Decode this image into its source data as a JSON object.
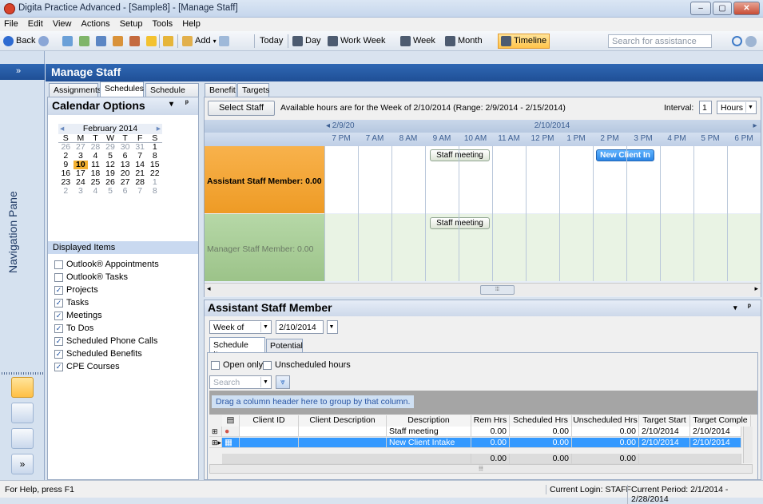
{
  "window": {
    "title": "Digita Practice Advanced - [Sample8] - [Manage Staff]",
    "min": "–",
    "max": "▢",
    "close": "✕"
  },
  "menu": [
    "File",
    "Edit",
    "View",
    "Actions",
    "Setup",
    "Tools",
    "Help"
  ],
  "toolbar": {
    "back": "Back",
    "add": "Add",
    "today": "Today",
    "day": "Day",
    "work_week": "Work Week",
    "week": "Week",
    "month": "Month",
    "timeline": "Timeline",
    "search_placeholder": "Search for assistance"
  },
  "nav": {
    "label": "Navigation Pane",
    "collapse": "»",
    "expand": "»"
  },
  "header": {
    "title": "Manage Staff"
  },
  "tabs_left": [
    "Assignments",
    "Schedules",
    "Schedule Items"
  ],
  "tabs_right": [
    "Benefit",
    "Targets"
  ],
  "calendar_options": {
    "title": "Calendar Options",
    "menu": "▾",
    "pin": "ᵖ",
    "month": "February 2014",
    "prev": "◂",
    "next": "▸",
    "weekdays": [
      "S",
      "M",
      "T",
      "W",
      "T",
      "F",
      "S"
    ],
    "weeks": [
      [
        "26",
        "27",
        "28",
        "29",
        "30",
        "31",
        "1"
      ],
      [
        "2",
        "3",
        "4",
        "5",
        "6",
        "7",
        "8"
      ],
      [
        "9",
        "10",
        "11",
        "12",
        "13",
        "14",
        "15"
      ],
      [
        "16",
        "17",
        "18",
        "19",
        "20",
        "21",
        "22"
      ],
      [
        "23",
        "24",
        "25",
        "26",
        "27",
        "28",
        "1"
      ],
      [
        "2",
        "3",
        "4",
        "5",
        "6",
        "7",
        "8"
      ]
    ],
    "today": "10",
    "displayed_items_title": "Displayed Items",
    "items": [
      {
        "label": "Outlook® Appointments",
        "checked": false,
        "mark": ""
      },
      {
        "label": "Outlook® Tasks",
        "checked": false,
        "mark": ""
      },
      {
        "label": "Projects",
        "checked": true,
        "mark": "✓"
      },
      {
        "label": "Tasks",
        "checked": true,
        "mark": "✓"
      },
      {
        "label": "Meetings",
        "checked": true,
        "mark": "✓"
      },
      {
        "label": "To Dos",
        "checked": true,
        "mark": "✓"
      },
      {
        "label": "Scheduled Phone Calls",
        "checked": true,
        "mark": "✓"
      },
      {
        "label": "Scheduled Benefits",
        "checked": true,
        "mark": "✓"
      },
      {
        "label": "CPE Courses",
        "checked": true,
        "mark": "✓"
      }
    ]
  },
  "schedule": {
    "select_staff": "Select Staff",
    "available_hours": "Available hours are for the Week of 2/10/2014 (Range: 2/9/2014 - 2/15/2014)",
    "interval_label": "Interval:",
    "interval_value": "1",
    "interval_unit": "Hours",
    "prev_date": "◂ 2/9/20",
    "date": "2/10/2014",
    "next_arrow": "▸",
    "hours": [
      "7 PM",
      "7 AM",
      "8 AM",
      "9 AM",
      "10 AM",
      "11 AM",
      "12 PM",
      "1 PM",
      "2 PM",
      "3 PM",
      "4 PM",
      "5 PM",
      "6 PM"
    ],
    "rows": [
      {
        "label": "Assistant Staff Member: 0.00",
        "color": "#f4a535"
      },
      {
        "label": "Manager Staff Member: 0.00",
        "color": "#a9cf98"
      }
    ],
    "appointments": [
      {
        "title": "Staff meeting"
      },
      {
        "title": "New Client In"
      },
      {
        "title": "Staff meeting"
      }
    ],
    "scroll_grip": "⦙⦙⦙",
    "left_arrow": "◂",
    "right_arrow": "▸"
  },
  "staff_panel": {
    "title": "Assistant Staff Member",
    "period": "Week of",
    "date": "2/10/2014",
    "tabs": [
      "Schedule Items",
      "Potential"
    ],
    "open_only": "Open only",
    "unscheduled_hours": "Unscheduled hours",
    "search_placeholder": "Search",
    "group_hint": "Drag a column header here to group by that column.",
    "columns": [
      "Client ID",
      "Client Description",
      "Description",
      "Rem Hrs",
      "Scheduled Hrs",
      "Unscheduled Hrs",
      "Target Start",
      "Target Comple"
    ],
    "rows": [
      {
        "client_id": "",
        "client_description": "",
        "description": "Staff meeting",
        "rem": "0.00",
        "sched": "0.00",
        "unsched": "0.00",
        "start": "2/10/2014",
        "complete": "2/10/2014"
      },
      {
        "client_id": "",
        "client_description": "",
        "description": "New Client Intake",
        "rem": "0.00",
        "sched": "0.00",
        "unsched": "0.00",
        "start": "2/10/2014",
        "complete": "2/10/2014"
      }
    ],
    "totals": {
      "rem": "0.00",
      "sched": "0.00",
      "unsched": "0.00"
    },
    "hscroll_grip": "⦙⦙⦙"
  },
  "status": {
    "help": "For Help, press F1",
    "login": "Current Login: STAFF",
    "period": "Current Period: 2/1/2014 - 2/28/2014"
  },
  "colors": {
    "accent": "#1f4f96",
    "selection": "#3399ff",
    "assistant_row": "#f4a535",
    "manager_row": "#a9cf98"
  }
}
